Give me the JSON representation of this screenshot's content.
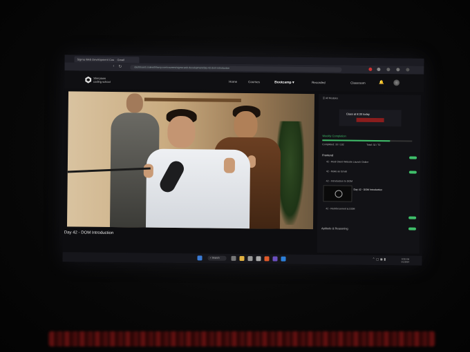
{
  "browser": {
    "tabs": [
      "Sigma Web Development Course",
      "Gmail"
    ],
    "url": "dashboard.codewithharry.com/courses/sigma-web-development/day-42-dom-introduction"
  },
  "site": {
    "brand_line1": "Sheryians",
    "brand_line2": "coding school",
    "nav": [
      "Home",
      "Courses",
      "Bootcamp",
      "Recorded",
      "Classroom"
    ]
  },
  "video": {
    "title": "Day 42 - DOM Introduction"
  },
  "panel": {
    "all_modules": "All Modules",
    "class_time": "Class at 8:30 today",
    "section_title": "Weekly Completion",
    "progress_left": "Completed: 33 / 102",
    "progress_right": "Total: 32 / 70",
    "section_header": "Frontend",
    "items": [
      "42 - Real Client Website Launch Online",
      "42 - Make an Email",
      "42 - Introduction to DOM",
      "Day 42 - DOM Introduction",
      "42 - Reinforcement & DOM",
      "Aptitude & Reasoning"
    ]
  },
  "taskbar": {
    "search": "Search",
    "time": "8:30 PM",
    "date": "5/1/2024"
  },
  "colors": {
    "accent_green": "#3fbf6a",
    "countdown_red": "#8a1d1d"
  }
}
